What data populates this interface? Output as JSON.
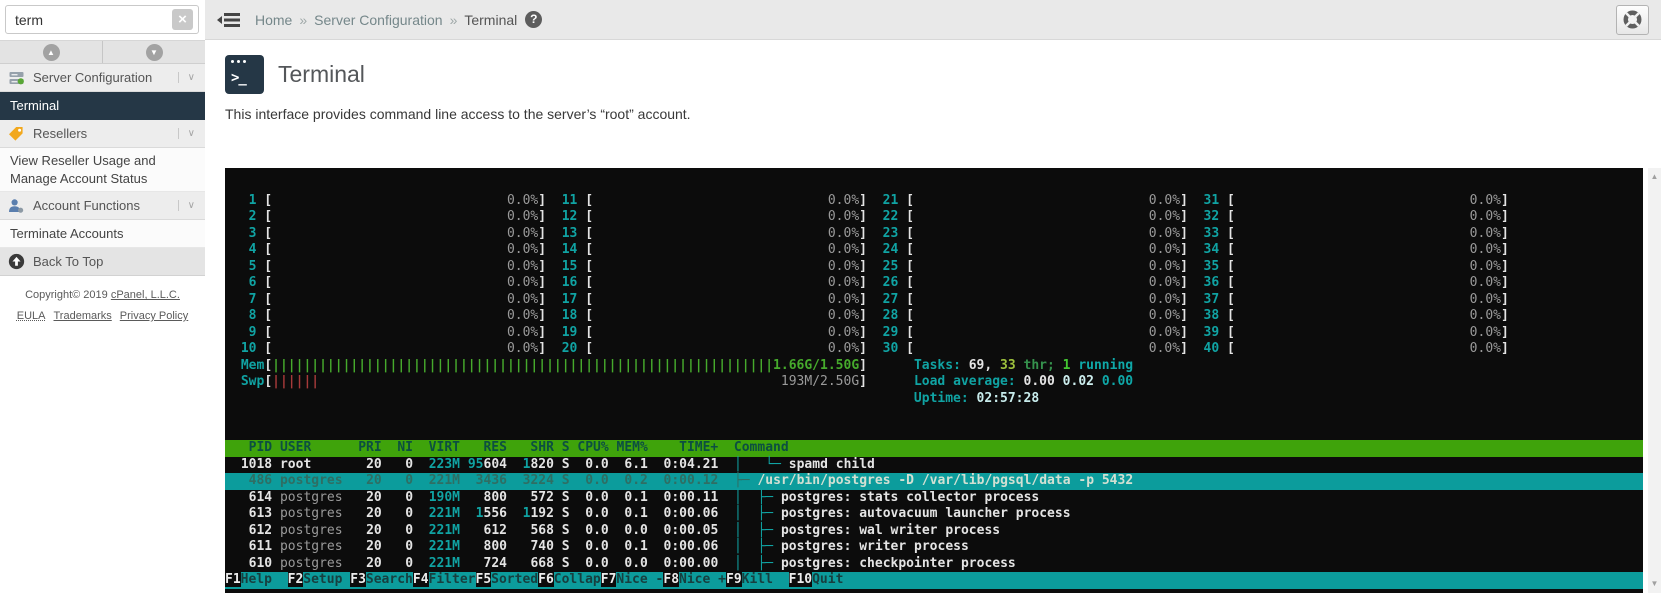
{
  "sidebar": {
    "search": {
      "value": "term",
      "clear_glyph": "×"
    },
    "nav_buttons": {
      "up_glyph": "▲",
      "down_glyph": "▼"
    },
    "menu": [
      {
        "type": "header",
        "label": "Server Configuration",
        "icon": "server-icon",
        "chevron": "∨"
      },
      {
        "type": "item",
        "label": "Terminal",
        "selected": true
      },
      {
        "type": "header",
        "label": "Resellers",
        "icon": "tag-icon",
        "chevron": "∨"
      },
      {
        "type": "item",
        "label": "View Reseller Usage and Manage Account Status"
      },
      {
        "type": "header",
        "label": "Account Functions",
        "icon": "user-icon",
        "chevron": "∨"
      },
      {
        "type": "item",
        "label": "Terminate Accounts"
      },
      {
        "type": "top",
        "label": "Back To Top",
        "icon": "arrow-up-circle-icon"
      }
    ],
    "footer": {
      "copyright_prefix": "Copyright© 2019 ",
      "copyright_link": "cPanel, L.L.C.",
      "links": [
        "EULA",
        "Trademarks",
        "Privacy Policy"
      ]
    }
  },
  "topbar": {
    "separator": "»",
    "breadcrumb": [
      {
        "label": "Home"
      },
      {
        "label": "Server Configuration"
      },
      {
        "label": "Terminal",
        "current": true
      }
    ],
    "help_glyph": "?"
  },
  "main": {
    "title": "Terminal",
    "icon_glyph": ">_",
    "description": "This interface provides command line access to the server’s “root” account."
  },
  "terminal": {
    "cpu_value": "0.0",
    "cpu_values": [
      "0.0",
      "0.0",
      "0.0",
      "0.0",
      "0.0",
      "0.0",
      "0.0",
      "0.0",
      "0.0",
      "0.0",
      "0.0",
      "0.0",
      "0.0",
      "0.0",
      "0.0",
      "0.0",
      "0.0",
      "0.0",
      "0.0",
      "0.0",
      "0.0",
      "0.0",
      "0.0",
      "0.0",
      "0.0",
      "0.0",
      "0.0",
      "0.0",
      "0.0",
      "0.0",
      "0.0",
      "0.0",
      "0.0",
      "0.0",
      "0.0",
      "0.0",
      "0.0",
      "0.0",
      "0.0",
      "0.0"
    ],
    "mem": {
      "label": "Mem",
      "text": "1.66G/1.50G",
      "bars": 64
    },
    "swp": {
      "label": "Swp",
      "text": "193M/2.50G",
      "bars": 6
    },
    "tasks": {
      "label": "Tasks: ",
      "total": "69,",
      "threads": "33",
      "thr": "thr;",
      "running_count": "1",
      "running": "running"
    },
    "load": {
      "label": "Load average: ",
      "values": [
        "0.00",
        "0.02",
        "0.00"
      ]
    },
    "uptime": {
      "label": "Uptime: ",
      "value": "02:57:28"
    },
    "process_table": {
      "headers": {
        "pid": "PID",
        "user": "USER",
        "pri": "PRI",
        "ni": "NI",
        "virt": "VIRT",
        "res": "RES",
        "shr": "SHR",
        "s": "S",
        "cpu": "CPU%",
        "mem": "MEM%",
        "time": "TIME+",
        "command": "Command"
      },
      "rows": [
        {
          "pid": "1018",
          "user": "root",
          "pri": "20",
          "ni": "0",
          "virt": "223M",
          "res": "95604",
          "shr": "1820",
          "s": "S",
          "cpu": "0.0",
          "mem": "6.1",
          "time": "0:04.21",
          "tree": "│   └─ ",
          "command": "spamd child",
          "selected": false
        },
        {
          "pid": "486",
          "user": "postgres",
          "pri": "20",
          "ni": "0",
          "virt": "221M",
          "res": "3436",
          "shr": "3224",
          "s": "S",
          "cpu": "0.0",
          "mem": "0.2",
          "time": "0:00.12",
          "tree": "├─ ",
          "command": "/usr/bin/postgres -D /var/lib/pgsql/data -p 5432",
          "selected": true
        },
        {
          "pid": "614",
          "user": "postgres",
          "pri": "20",
          "ni": "0",
          "virt": "190M",
          "res": "800",
          "shr": "572",
          "s": "S",
          "cpu": "0.0",
          "mem": "0.1",
          "time": "0:00.11",
          "tree": "│  ├─ ",
          "command": "postgres: stats collector process",
          "selected": false
        },
        {
          "pid": "613",
          "user": "postgres",
          "pri": "20",
          "ni": "0",
          "virt": "221M",
          "res": "1556",
          "shr": "1192",
          "s": "S",
          "cpu": "0.0",
          "mem": "0.1",
          "time": "0:00.06",
          "tree": "│  ├─ ",
          "command": "postgres: autovacuum launcher process",
          "selected": false
        },
        {
          "pid": "612",
          "user": "postgres",
          "pri": "20",
          "ni": "0",
          "virt": "221M",
          "res": "612",
          "shr": "568",
          "s": "S",
          "cpu": "0.0",
          "mem": "0.0",
          "time": "0:00.05",
          "tree": "│  ├─ ",
          "command": "postgres: wal writer process",
          "selected": false
        },
        {
          "pid": "611",
          "user": "postgres",
          "pri": "20",
          "ni": "0",
          "virt": "221M",
          "res": "800",
          "shr": "740",
          "s": "S",
          "cpu": "0.0",
          "mem": "0.1",
          "time": "0:00.06",
          "tree": "│  ├─ ",
          "command": "postgres: writer process",
          "selected": false
        },
        {
          "pid": "610",
          "user": "postgres",
          "pri": "20",
          "ni": "0",
          "virt": "221M",
          "res": "724",
          "shr": "668",
          "s": "S",
          "cpu": "0.0",
          "mem": "0.0",
          "time": "0:00.00",
          "tree": "│  ├─ ",
          "command": "postgres: checkpointer process",
          "selected": false
        }
      ]
    },
    "fkeys": [
      [
        "F1",
        "Help"
      ],
      [
        "F2",
        "Setup"
      ],
      [
        "F3",
        "Search"
      ],
      [
        "F4",
        "Filter"
      ],
      [
        "F5",
        "Sorted"
      ],
      [
        "F6",
        "Collap"
      ],
      [
        "F7",
        "Nice -"
      ],
      [
        "F8",
        "Nice +"
      ],
      [
        "F9",
        "Kill"
      ],
      [
        "F10",
        "Quit"
      ]
    ],
    "colors": {
      "terminal_bg": "#0c0c0c",
      "header_green": "#3fa30b",
      "selection_cyan": "#0c9c9c",
      "text_cyan": "#10a3a3",
      "mem_green": "#46aa2c",
      "swap_red": "#a63a3a",
      "sidebar_selected_bg": "#253746"
    }
  }
}
